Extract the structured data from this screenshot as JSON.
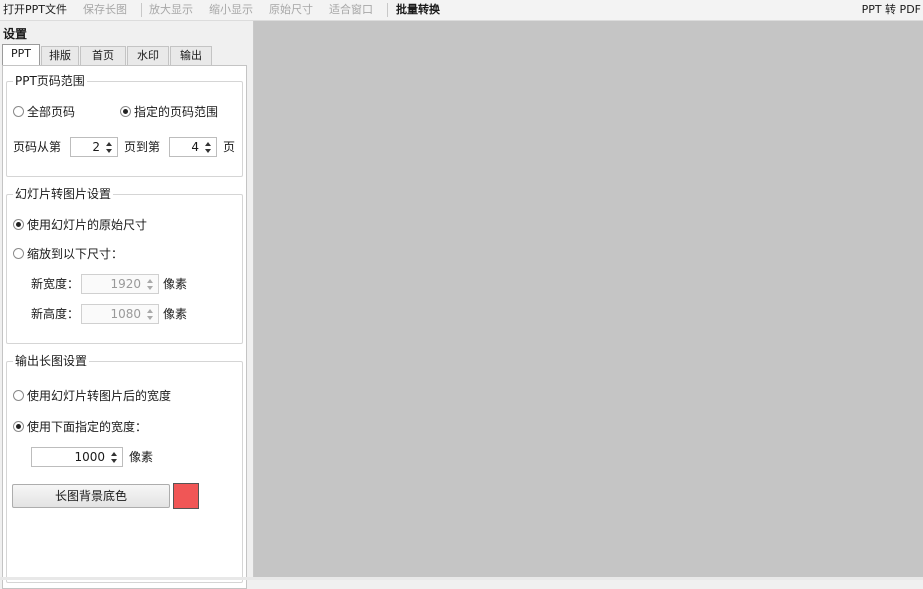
{
  "toolbar": {
    "open": "打开PPT文件",
    "save": "保存长图",
    "zoom_in": "放大显示",
    "zoom_out": "缩小显示",
    "original": "原始尺寸",
    "fit": "适合窗口",
    "batch": "批量转换",
    "app_title": "PPT 转 PDF"
  },
  "panel": {
    "title": "设置",
    "tabs": [
      "PPT",
      "排版",
      "首页",
      "水印",
      "输出"
    ],
    "active_tab": "PPT"
  },
  "page_range": {
    "legend": "PPT页码范围",
    "all_pages": "全部页码",
    "specified_range": "指定的页码范围",
    "selected": "specified",
    "from_label": "页码从第",
    "from_value": "2",
    "to_label": "页到第",
    "to_value": "4",
    "page_suffix": "页"
  },
  "slide_image": {
    "legend": "幻灯片转图片设置",
    "original_size": "使用幻灯片的原始尺寸",
    "scale_to": "缩放到以下尺寸：",
    "selected": "original",
    "width_label": "新宽度：",
    "width_value": "1920",
    "height_label": "新高度：",
    "height_value": "1080",
    "unit": "像素"
  },
  "long_image": {
    "legend": "输出长图设置",
    "use_slide_width": "使用幻灯片转图片后的宽度",
    "use_specified_width": "使用下面指定的宽度：",
    "selected": "specified",
    "width_value": "1000",
    "unit": "像素",
    "bg_button": "长图背景底色",
    "bg_color": "#f05656"
  },
  "colors": {
    "preview_bg": "#c5c5c5"
  }
}
